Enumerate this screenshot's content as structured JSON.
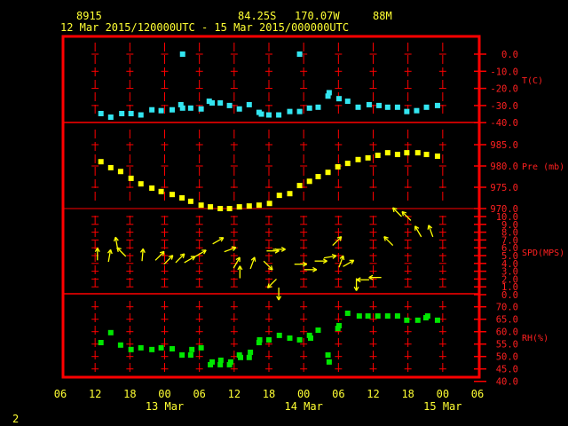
{
  "header": {
    "station": "8915",
    "lat": "84.25S",
    "lon": "170.07W",
    "elev": "88M",
    "range": "12 Mar 2015/120000UTC - 15 Mar 2015/000000UTC"
  },
  "footer": {
    "page": "2"
  },
  "colors": {
    "frame": "#ff0000",
    "text": "#ffff33",
    "temp": "#33e5f0",
    "pres": "#ffff00",
    "wind": "#ffff00",
    "rh": "#00e600"
  },
  "chart_data": {
    "type": "scatter",
    "x_unit": "hours since 12 Mar 2015 06 UTC",
    "xlim": [
      0,
      72
    ],
    "x_ticks": [
      "06",
      "12",
      "18",
      "00",
      "06",
      "12",
      "18",
      "00",
      "06",
      "12",
      "18",
      "00",
      "06"
    ],
    "x_dates": [
      {
        "label": "13 Mar",
        "tick": 3
      },
      {
        "label": "14 Mar",
        "tick": 7
      },
      {
        "label": "15 Mar",
        "tick": 11
      }
    ],
    "panels": [
      {
        "name": "temperature",
        "unit_label": "T(C)",
        "ylim": [
          -40,
          0
        ],
        "tick_labels": [
          "0.0",
          "-10.0",
          "-20.0",
          "-30.0",
          "-40.0"
        ],
        "ticks": [
          0,
          -10,
          -20,
          -30,
          -40
        ],
        "points": [
          [
            7.0,
            -34.7
          ],
          [
            8.7,
            -36.8
          ],
          [
            10.6,
            -34.7
          ],
          [
            12.2,
            -34.7
          ],
          [
            13.9,
            -35.5
          ],
          [
            15.8,
            -32.5
          ],
          [
            17.4,
            -33
          ],
          [
            19.3,
            -32.5
          ],
          [
            20.8,
            -29.5
          ],
          [
            21.1,
            -31.5
          ],
          [
            21.1,
            0
          ],
          [
            22.5,
            -31.5
          ],
          [
            24.3,
            -32
          ],
          [
            25.7,
            -27.5
          ],
          [
            26.2,
            -28.5
          ],
          [
            27.6,
            -28.5
          ],
          [
            29.2,
            -30
          ],
          [
            30.9,
            -32
          ],
          [
            32.6,
            -29.5
          ],
          [
            34.3,
            -34
          ],
          [
            34.7,
            -35
          ],
          [
            36.0,
            -35.5
          ],
          [
            37.7,
            -35.5
          ],
          [
            39.6,
            -33.5
          ],
          [
            41.3,
            -33.5
          ],
          [
            41.3,
            0
          ],
          [
            43.0,
            -31.5
          ],
          [
            44.5,
            -31
          ],
          [
            46.2,
            -24.5
          ],
          [
            46.4,
            -22.5
          ],
          [
            48.1,
            -26
          ],
          [
            49.6,
            -27.5
          ],
          [
            51.4,
            -31
          ],
          [
            53.3,
            -29.5
          ],
          [
            55.0,
            -30
          ],
          [
            56.5,
            -31
          ],
          [
            58.2,
            -31
          ],
          [
            59.8,
            -33.5
          ],
          [
            61.5,
            -33
          ],
          [
            63.2,
            -31
          ],
          [
            65.1,
            -30
          ]
        ]
      },
      {
        "name": "pressure",
        "unit_label": "Pre (mb)",
        "ylim": [
          970,
          990
        ],
        "tick_labels": [
          "985.0",
          "980.0",
          "975.0",
          "970.0"
        ],
        "ticks": [
          985,
          980,
          975,
          970
        ],
        "points": [
          [
            7.0,
            981.0
          ],
          [
            8.7,
            979.6
          ],
          [
            10.4,
            978.7
          ],
          [
            12.2,
            977.1
          ],
          [
            13.9,
            975.8
          ],
          [
            15.8,
            974.8
          ],
          [
            17.4,
            974.0
          ],
          [
            19.3,
            973.3
          ],
          [
            21.0,
            972.5
          ],
          [
            22.5,
            971.7
          ],
          [
            24.3,
            970.8
          ],
          [
            25.9,
            970.4
          ],
          [
            27.6,
            970.0
          ],
          [
            29.2,
            970.0
          ],
          [
            30.9,
            970.4
          ],
          [
            32.6,
            970.6
          ],
          [
            34.3,
            970.8
          ],
          [
            36.1,
            971.2
          ],
          [
            37.8,
            973.1
          ],
          [
            39.6,
            973.5
          ],
          [
            41.3,
            975.4
          ],
          [
            43.0,
            976.4
          ],
          [
            44.5,
            977.5
          ],
          [
            46.2,
            978.5
          ],
          [
            47.9,
            979.8
          ],
          [
            49.6,
            980.6
          ],
          [
            51.4,
            981.5
          ],
          [
            53.1,
            981.9
          ],
          [
            54.8,
            982.5
          ],
          [
            56.5,
            983.1
          ],
          [
            58.2,
            982.7
          ],
          [
            59.8,
            983.1
          ],
          [
            61.7,
            983.1
          ],
          [
            63.2,
            982.7
          ],
          [
            65.1,
            982.3
          ]
        ]
      },
      {
        "name": "wind",
        "unit_label": "SPD(MPS)",
        "ylim": [
          0,
          11
        ],
        "tick_labels": [
          "10.0",
          "9.0",
          "8.0",
          "7.0",
          "6.0",
          "5.0",
          "4.0",
          "3.0",
          "2.0",
          "1.0",
          "0.0"
        ],
        "ticks": [
          10,
          9,
          8,
          7,
          6,
          5,
          4,
          3,
          2,
          1,
          0
        ],
        "vectors_note": "[hour, speed, arrow direction deg clockwise from up]",
        "vectors": [
          [
            6.4,
            4.4,
            0
          ],
          [
            8.3,
            4.2,
            10
          ],
          [
            9.9,
            5.8,
            350
          ],
          [
            11.3,
            4.9,
            315
          ],
          [
            14.1,
            4.3,
            5
          ],
          [
            16.4,
            4.4,
            45
          ],
          [
            17.9,
            3.9,
            45
          ],
          [
            19.9,
            4.1,
            45
          ],
          [
            21.4,
            4.1,
            60
          ],
          [
            23.3,
            4.9,
            60
          ],
          [
            26.3,
            6.5,
            60
          ],
          [
            28.3,
            5.5,
            70
          ],
          [
            29.9,
            3.4,
            30
          ],
          [
            31.0,
            2.1,
            0
          ],
          [
            32.8,
            3.3,
            20
          ],
          [
            35.1,
            4.3,
            135
          ],
          [
            35.6,
            5.6,
            90
          ],
          [
            36.7,
            5.8,
            90
          ],
          [
            37.3,
            2.0,
            225
          ],
          [
            37.7,
            0.9,
            180
          ],
          [
            40.4,
            3.9,
            90
          ],
          [
            42.1,
            3.2,
            90
          ],
          [
            43.9,
            4.3,
            90
          ],
          [
            45.5,
            4.7,
            80
          ],
          [
            47.0,
            6.3,
            45
          ],
          [
            48.1,
            3.5,
            20
          ],
          [
            48.8,
            3.6,
            60
          ],
          [
            51.1,
            2.1,
            180
          ],
          [
            53.3,
            1.9,
            270
          ],
          [
            55.4,
            2.2,
            270
          ],
          [
            57.4,
            6.3,
            315
          ],
          [
            58.9,
            10.0,
            315
          ],
          [
            60.5,
            9.5,
            315
          ],
          [
            62.3,
            7.4,
            330
          ],
          [
            64.3,
            7.4,
            340
          ]
        ]
      },
      {
        "name": "relative-humidity",
        "unit_label": "RH(%)",
        "ylim": [
          40,
          72.5
        ],
        "tick_labels": [
          "70.0",
          "65.0",
          "60.0",
          "55.0",
          "50.0",
          "45.0",
          "40.0"
        ],
        "ticks": [
          70,
          65,
          60,
          55,
          50,
          45,
          40
        ],
        "points": [
          [
            7.0,
            55.6
          ],
          [
            8.7,
            59.6
          ],
          [
            10.4,
            54.6
          ],
          [
            12.2,
            52.8
          ],
          [
            13.9,
            53.5
          ],
          [
            15.8,
            52.8
          ],
          [
            17.4,
            53.5
          ],
          [
            19.3,
            53.1
          ],
          [
            21.0,
            50.6
          ],
          [
            22.5,
            50.6
          ],
          [
            22.7,
            52.8
          ],
          [
            24.3,
            53.5
          ],
          [
            25.9,
            46.7
          ],
          [
            26.2,
            47.8
          ],
          [
            27.6,
            46.7
          ],
          [
            27.7,
            48.5
          ],
          [
            29.2,
            46.7
          ],
          [
            29.4,
            47.8
          ],
          [
            30.9,
            50.6
          ],
          [
            31.1,
            49.6
          ],
          [
            32.6,
            49.6
          ],
          [
            32.8,
            51.7
          ],
          [
            34.3,
            55.6
          ],
          [
            34.4,
            56.7
          ],
          [
            36.0,
            56.7
          ],
          [
            37.8,
            58.5
          ],
          [
            39.6,
            57.4
          ],
          [
            41.3,
            56.7
          ],
          [
            43.0,
            58.5
          ],
          [
            43.2,
            57.4
          ],
          [
            44.5,
            60.6
          ],
          [
            46.2,
            50.6
          ],
          [
            46.4,
            47.8
          ],
          [
            47.9,
            61.3
          ],
          [
            48.1,
            62.4
          ],
          [
            49.6,
            67.4
          ],
          [
            51.6,
            66.3
          ],
          [
            53.1,
            66.3
          ],
          [
            54.8,
            66.3
          ],
          [
            56.5,
            66.3
          ],
          [
            58.2,
            66.3
          ],
          [
            59.8,
            64.6
          ],
          [
            61.7,
            64.6
          ],
          [
            63.1,
            65.6
          ],
          [
            63.4,
            66.3
          ],
          [
            65.1,
            64.6
          ]
        ]
      }
    ]
  }
}
